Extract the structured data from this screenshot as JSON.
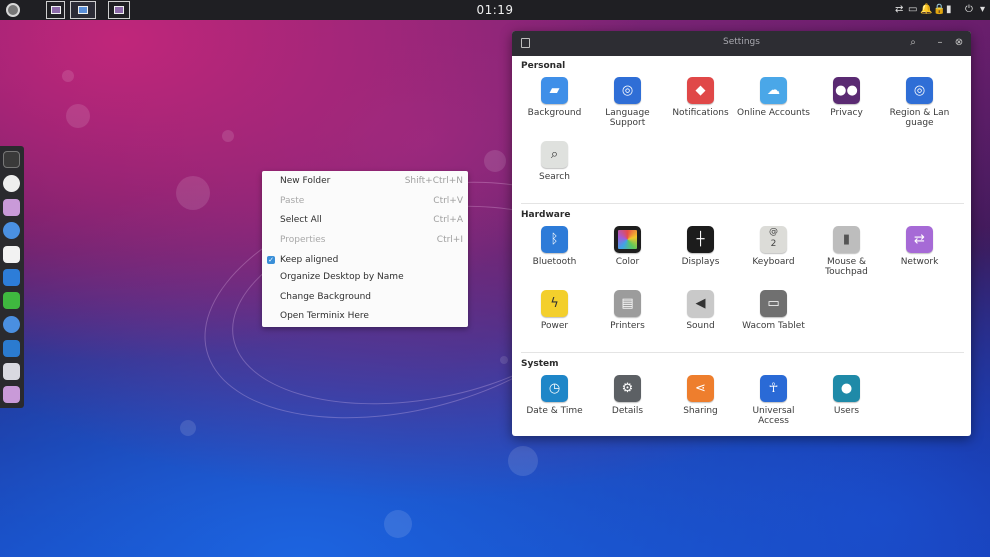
{
  "top_panel": {
    "clock": "01:19",
    "tray": [
      "⇄",
      "▭",
      "🔔",
      "🔒",
      "▮",
      "⏻",
      "▾"
    ]
  },
  "context_menu": {
    "items": [
      {
        "label": "New Folder",
        "shortcut": "Shift+Ctrl+N",
        "enabled": true
      },
      {
        "label": "Paste",
        "shortcut": "Ctrl+V",
        "enabled": false
      },
      {
        "label": "Select All",
        "shortcut": "Ctrl+A",
        "enabled": true
      },
      {
        "label": "Properties",
        "shortcut": "Ctrl+I",
        "enabled": false
      },
      {
        "label": "Keep aligned",
        "checked": true,
        "enabled": true
      },
      {
        "label": "Organize Desktop by Name",
        "enabled": true
      },
      {
        "label": "Change Background",
        "enabled": true
      },
      {
        "label": "Open Terminix Here",
        "enabled": true
      }
    ]
  },
  "settings": {
    "title": "Settings",
    "sections": {
      "personal": {
        "title": "Personal",
        "items": [
          {
            "label": "Background",
            "icon": "background-icon",
            "color": "#3f8fe8"
          },
          {
            "label": "Language Support",
            "icon": "language-icon",
            "color": "#2f6ed6"
          },
          {
            "label": "Notifications",
            "icon": "bell-icon",
            "color": "#e04848"
          },
          {
            "label": "Online Accounts",
            "icon": "cloud-icon",
            "color": "#4aa7e8"
          },
          {
            "label": "Privacy",
            "icon": "mask-icon",
            "color": "#5a2a72"
          },
          {
            "label": "Region & Lan guage",
            "icon": "globe-icon",
            "color": "#2f6ed6"
          },
          {
            "label": "Search",
            "icon": "search-icon",
            "color": "#dfe1de"
          }
        ]
      },
      "hardware": {
        "title": "Hardware",
        "items": [
          {
            "label": "Bluetooth",
            "icon": "bluetooth-icon",
            "color": "#2d7bd8"
          },
          {
            "label": "Color",
            "icon": "color-icon",
            "color": "#1e1e1e"
          },
          {
            "label": "Displays",
            "icon": "displays-icon",
            "color": "#1c1c1c"
          },
          {
            "label": "Keyboard",
            "icon": "keyboard-icon",
            "color": "#dcdcd8"
          },
          {
            "label": "Mouse & Touchpad",
            "icon": "mouse-icon",
            "color": "#bdbdbd"
          },
          {
            "label": "Network",
            "icon": "network-icon",
            "color": "#a66ad6"
          },
          {
            "label": "Power",
            "icon": "power-icon",
            "color": "#f3cf2c"
          },
          {
            "label": "Printers",
            "icon": "printer-icon",
            "color": "#9c9c9c"
          },
          {
            "label": "Sound",
            "icon": "sound-icon",
            "color": "#c9c9c9"
          },
          {
            "label": "Wacom Tablet",
            "icon": "tablet-icon",
            "color": "#707070"
          }
        ]
      },
      "system": {
        "title": "System",
        "items": [
          {
            "label": "Date & Time",
            "icon": "clock-icon",
            "color": "#1e86c8"
          },
          {
            "label": "Details",
            "icon": "gear-icon",
            "color": "#5c6064"
          },
          {
            "label": "Sharing",
            "icon": "share-icon",
            "color": "#ee7e2d"
          },
          {
            "label": "Universal Access",
            "icon": "accessibility-icon",
            "color": "#2a6ad6"
          },
          {
            "label": "Users",
            "icon": "user-icon",
            "color": "#1f8aa8"
          }
        ]
      }
    }
  }
}
